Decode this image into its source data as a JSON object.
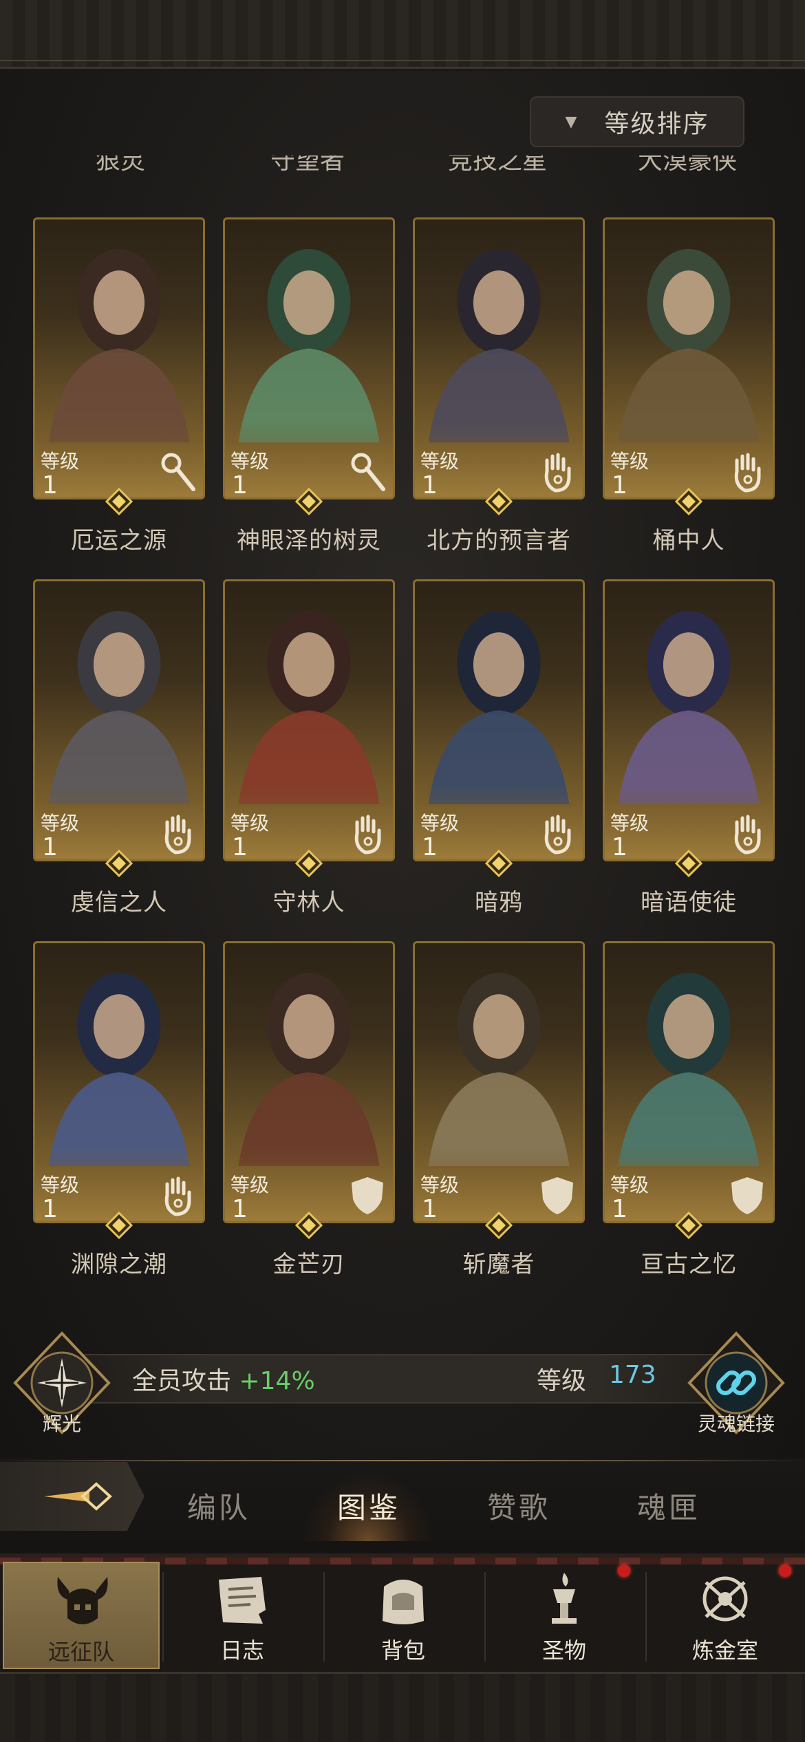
{
  "sort_button": {
    "label": "等级排序"
  },
  "cut_off_names": [
    "狠灵",
    "守望者",
    "竞技之星",
    "大漠豪侠"
  ],
  "level_label": "等级",
  "heroes": [
    {
      "name": "厄运之源",
      "level": "1",
      "role_icon": "staff-icon"
    },
    {
      "name": "神眼泽的树灵",
      "level": "1",
      "role_icon": "staff-icon"
    },
    {
      "name": "北方的预言者",
      "level": "1",
      "role_icon": "hand-icon"
    },
    {
      "name": "桶中人",
      "level": "1",
      "role_icon": "hand-icon"
    },
    {
      "name": "虔信之人",
      "level": "1",
      "role_icon": "hand-icon"
    },
    {
      "name": "守林人",
      "level": "1",
      "role_icon": "hand-icon"
    },
    {
      "name": "暗鸦",
      "level": "1",
      "role_icon": "hand-icon"
    },
    {
      "name": "暗语使徒",
      "level": "1",
      "role_icon": "hand-icon"
    },
    {
      "name": "渊隙之潮",
      "level": "1",
      "role_icon": "hand-icon"
    },
    {
      "name": "金芒刃",
      "level": "1",
      "role_icon": "shield-icon"
    },
    {
      "name": "斩魔者",
      "level": "1",
      "role_icon": "shield-icon"
    },
    {
      "name": "亘古之忆",
      "level": "1",
      "role_icon": "shield-icon"
    }
  ],
  "bonus": {
    "left_emblem_label": "辉光",
    "attack_text": "全员攻击",
    "attack_value": "+14%",
    "level_text": "等级",
    "level_value": "173",
    "right_emblem_label": "灵魂链接"
  },
  "tabs": [
    {
      "label": "编队",
      "active": false
    },
    {
      "label": "图鉴",
      "active": true
    },
    {
      "label": "赞歌",
      "active": false
    },
    {
      "label": "魂匣",
      "active": false
    }
  ],
  "nav": [
    {
      "label": "远征队",
      "icon": "horned-helmet-icon",
      "active": true,
      "badge": false
    },
    {
      "label": "日志",
      "icon": "scroll-icon",
      "active": false,
      "badge": false
    },
    {
      "label": "背包",
      "icon": "backpack-icon",
      "active": false,
      "badge": false
    },
    {
      "label": "圣物",
      "icon": "relic-icon",
      "active": false,
      "badge": true
    },
    {
      "label": "炼金室",
      "icon": "alchemy-icon",
      "active": false,
      "badge": true
    }
  ],
  "colors": {
    "accent_gold": "#8a6d31",
    "attack_green": "#66cf66",
    "level_cyan": "#6cc8e2",
    "badge_red": "#c81d1d"
  }
}
